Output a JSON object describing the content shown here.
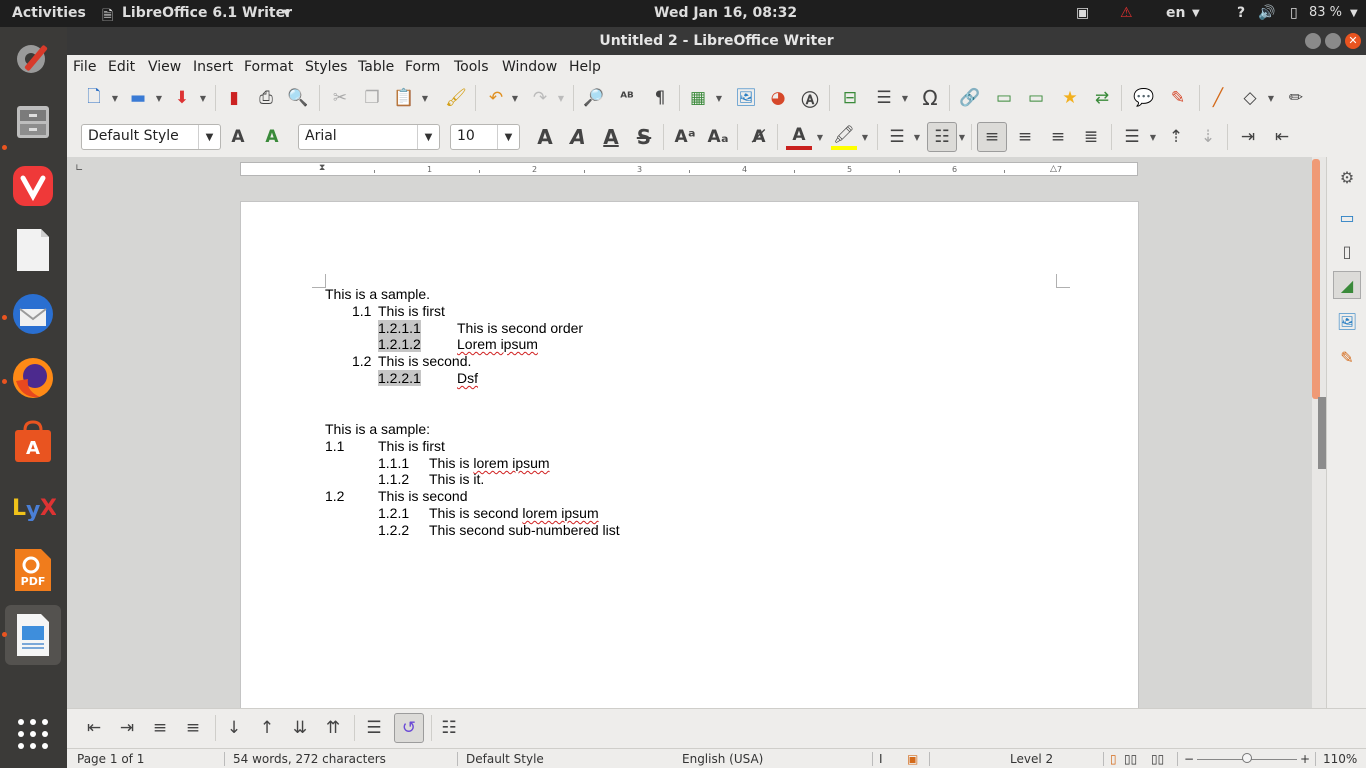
{
  "topbar": {
    "activities": "Activities",
    "app_name": "LibreOffice 6.1 Writer",
    "clock": "Wed Jan 16, 08:32",
    "lang": "en",
    "help": "?",
    "battery": "83 %"
  },
  "window": {
    "title": "Untitled 2 - LibreOffice Writer"
  },
  "menu": [
    "File",
    "Edit",
    "View",
    "Insert",
    "Format",
    "Styles",
    "Table",
    "Form",
    "Tools",
    "Window",
    "Help"
  ],
  "formatting": {
    "paragraph_style": "Default Style",
    "font_name": "Arial",
    "font_size": "10"
  },
  "ruler": {
    "numbers": [
      "1",
      "2",
      "3",
      "4",
      "5",
      "6",
      "7"
    ]
  },
  "document": {
    "block1": {
      "heading": "This is a sample.",
      "l1": {
        "num": "1.1",
        "text": "This is first"
      },
      "l2": {
        "num": "1.2.1.1",
        "text": "This is second order"
      },
      "l3": {
        "num": "1.2.1.2",
        "text": "Lorem ipsum"
      },
      "l4": {
        "num": "1.2",
        "text": "This is second."
      },
      "l5": {
        "num": "1.2.2.1",
        "text": "Dsf"
      }
    },
    "block2": {
      "heading": "This is a sample:",
      "l1": {
        "num": "1.1",
        "text": "This is first"
      },
      "l2": {
        "num": "1.1.1",
        "text_a": "This is ",
        "text_b": "lorem ipsum"
      },
      "l3": {
        "num": "1.1.2",
        "text": "This is it."
      },
      "l4": {
        "num": "1.2",
        "text": "This is second"
      },
      "l5": {
        "num": "1.2.1",
        "text_a": "This is second ",
        "text_b": "lorem ipsum"
      },
      "l6": {
        "num": "1.2.2",
        "text": "This second sub-numbered list"
      }
    }
  },
  "status": {
    "page": "Page 1 of 1",
    "words": "54 words, 272 characters",
    "page_style": "Default Style",
    "language": "English (USA)",
    "outline_level": "Level 2",
    "zoom": "110%"
  },
  "colors": {
    "accent": "#e95420",
    "font_color": "#c9211e",
    "highlight": "#ffff00",
    "dock_bg": "#3b3a38",
    "topbar_bg": "#1e1e1e"
  }
}
